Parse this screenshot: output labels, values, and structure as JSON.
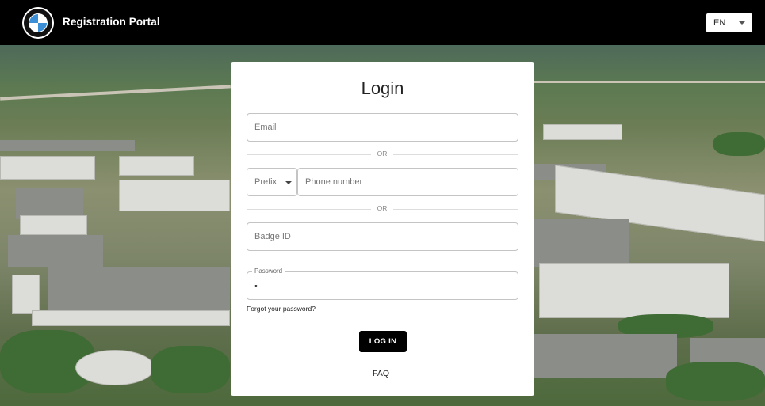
{
  "header": {
    "title": "Registration Portal",
    "logo_icon": "bmw-logo-icon",
    "language": "EN"
  },
  "login": {
    "title": "Login",
    "email_placeholder": "Email",
    "or_label": "OR",
    "prefix_label": "Prefix",
    "phone_placeholder": "Phone number",
    "badge_placeholder": "Badge ID",
    "password_label": "Password",
    "password_value": "•",
    "forgot_password": "Forgot your password?",
    "login_button": "LOG IN",
    "faq_link": "FAQ"
  },
  "colors": {
    "header_bg": "#000000",
    "card_bg": "#ffffff",
    "button_bg": "#000000",
    "brand_blue": "#3a8fd6"
  }
}
